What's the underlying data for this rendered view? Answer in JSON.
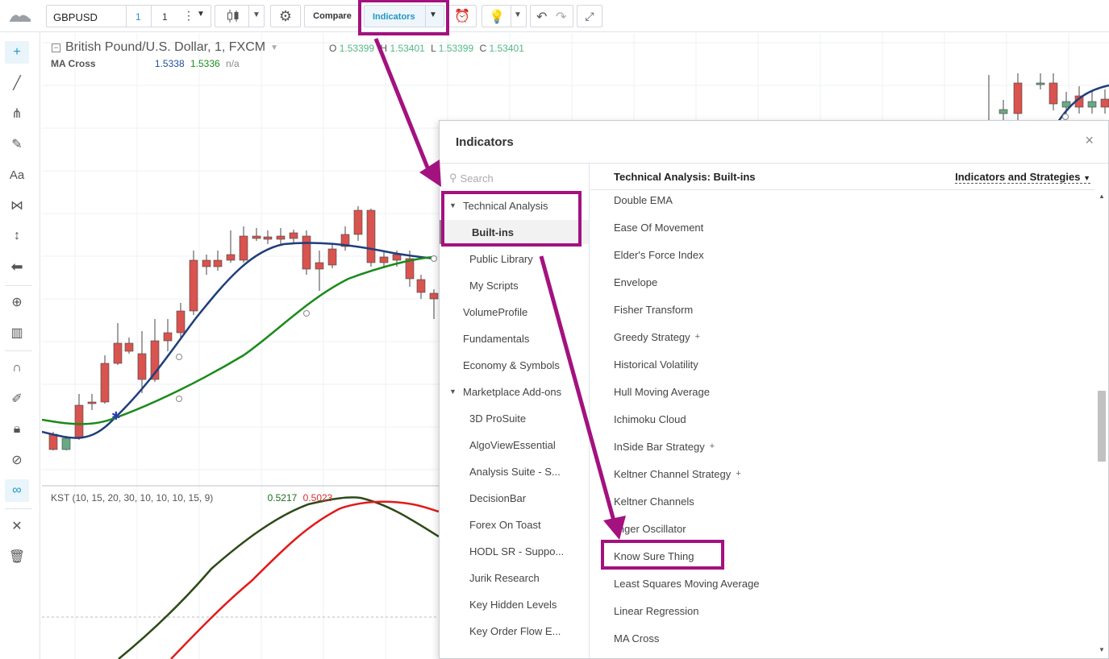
{
  "toolbar": {
    "symbol": "GBPUSD",
    "interval": "1",
    "interval_multiplier": "1",
    "compare_label": "Compare",
    "indicators_label": "Indicators",
    "icons": [
      "chart-logo-icon",
      "more-dots-icon",
      "chevron-down-icon",
      "candles-icon",
      "gear-icon",
      "alarm-clock-icon",
      "lightbulb-icon",
      "undo-icon",
      "redo-icon",
      "fullscreen-icon"
    ]
  },
  "sidebar": {
    "icons": [
      "crosshair-icon",
      "trend-line-icon",
      "pitchfork-icon",
      "brush-icon",
      "text-icon",
      "pattern-icon",
      "measure-icon",
      "arrow-left-icon",
      "zoom-in-icon",
      "ruler-icon",
      "magnet-icon",
      "pencil-lock-icon",
      "lock-icon",
      "eye-hidden-icon",
      "link-icon",
      "tools-icon",
      "trash-icon"
    ],
    "text_tool_label": "Aa"
  },
  "chart": {
    "title": "British Pound/U.S. Dollar, 1, FXCM",
    "ohlc": {
      "o_label": "O",
      "o": "1.53399",
      "h_label": "H",
      "h": "1.53401",
      "l_label": "L",
      "l": "1.53399",
      "c_label": "C",
      "c": "1.53401"
    },
    "ma_cross": {
      "label": "MA Cross",
      "v1": "1.5338",
      "v2": "1.5336",
      "v3": "n/a"
    },
    "kst": {
      "label": "KST (10, 15, 20, 30, 10, 10, 10, 15, 9)",
      "v1": "0.5217",
      "v2": "0.5023"
    },
    "colors": {
      "up": "#6aa883",
      "down": "#d9534f",
      "ma_fast": "#1f3e7a",
      "ma_slow": "#1b8a1b",
      "kst": "#2c4a17",
      "kst_signal": "#e11b1b"
    }
  },
  "dialog": {
    "title": "Indicators",
    "search_placeholder": "Search",
    "left_nav": {
      "technical_analysis": "Technical Analysis",
      "built_ins": "Built-ins",
      "public_library": "Public Library",
      "my_scripts": "My Scripts",
      "volume_profile": "VolumeProfile",
      "fundamentals": "Fundamentals",
      "economy_symbols": "Economy & Symbols",
      "marketplace": "Marketplace Add-ons",
      "addons": [
        "3D ProSuite",
        "AlgoViewEssential",
        "Analysis Suite - S...",
        "DecisionBar",
        "Forex On Toast",
        "HODL SR - Suppo...",
        "Jurik Research",
        "Key Hidden Levels",
        "Key Order Flow E..."
      ]
    },
    "right_header": "Technical Analysis: Built-ins",
    "filter_label": "Indicators and Strategies",
    "items": [
      "Double EMA",
      "Ease Of Movement",
      "Elder's Force Index",
      "Envelope",
      "Fisher Transform",
      "Greedy Strategy",
      "Historical Volatility",
      "Hull Moving Average",
      "Ichimoku Cloud",
      "InSide Bar Strategy",
      "Keltner Channel Strategy",
      "Keltner Channels",
      "linger Oscillator",
      "Know Sure Thing",
      "Least Squares Moving Average",
      "Linear Regression",
      "MA Cross"
    ],
    "strategy_mark": "+"
  },
  "annotation_color": "#a3127f"
}
